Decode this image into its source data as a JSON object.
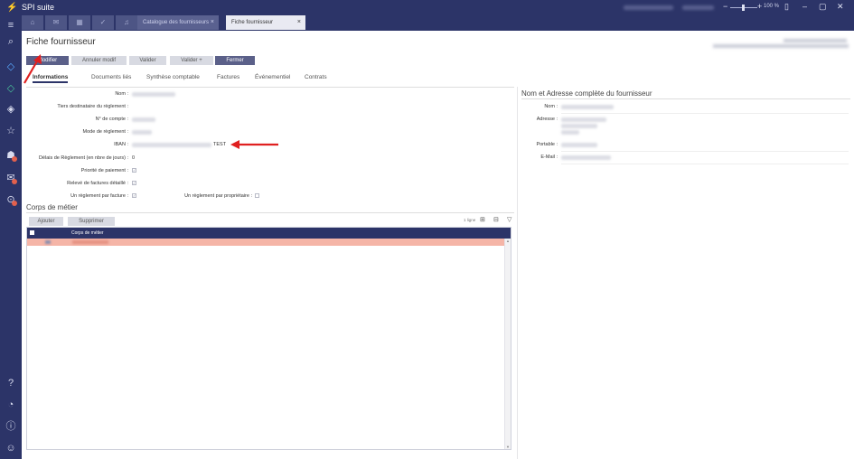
{
  "app": {
    "title": "SPI suite",
    "zoom": "100 %"
  },
  "tabs": [
    {
      "label": "Catalogue des fournisseurs",
      "close": "×"
    },
    {
      "label": "Fiche fournisseur",
      "close": "×"
    }
  ],
  "page": {
    "title": "Fiche fournisseur"
  },
  "toolbar": {
    "modifier": "Modifier",
    "annuler": "Annuler modif",
    "valider": "Valider",
    "valider_plus": "Valider +",
    "fermer": "Fermer"
  },
  "subtabs": [
    "Informations",
    "Documents liés",
    "Synthèse comptable",
    "Factures",
    "Événementiel",
    "Contrats"
  ],
  "form": {
    "nom": "Nom :",
    "tiers": "Tiers destinataire du règlement :",
    "num_compte": "N° de compte :",
    "mode_reglement": "Mode de règlement :",
    "iban": "IBAN :",
    "iban_suffix": "TEST",
    "delais": "Délais de Règlement (en nbre de jours) :",
    "delais_value": "0",
    "priorite": "Priorité de paiement :",
    "releve": "Relevé de factures détaillé :",
    "un_reglement": "Un règlement par facture :",
    "un_reglement_prop": "Un règlement par propriétaire :"
  },
  "corps": {
    "title": "Corps de métier",
    "ajouter": "Ajouter",
    "supprimer": "Supprimer",
    "count": "1 ligne",
    "col": "Corps de métier"
  },
  "address": {
    "title": "Nom et Adresse complète du fournisseur",
    "nom": "Nom :",
    "adresse": "Adresse :",
    "portable": "Portable :",
    "email": "E-Mail :"
  },
  "colors": {
    "brand": "#2c3468",
    "row_highlight": "#f5b5a7",
    "arrow": "#e02020"
  }
}
